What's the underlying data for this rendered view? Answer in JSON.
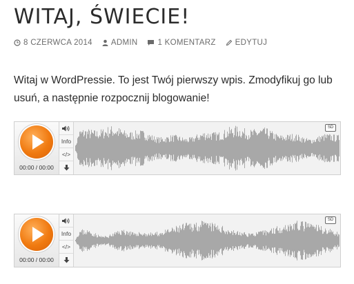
{
  "post": {
    "title": "WITAJ, ŚWIECIE!",
    "meta": {
      "date": "8 CZERWCA 2014",
      "author": "ADMIN",
      "comments": "1 KOMENTARZ",
      "edit": "EDYTUJ"
    },
    "content": "Witaj w WordPressie. To jest Twój pierwszy wpis. Zmodyfikuj go lub usuń, a następnie rozpocznij blogowanie!"
  },
  "players": [
    {
      "time": "00:00 / 00:00",
      "info_label": "Info",
      "embed_label": "</>",
      "quality_badge": "SD"
    },
    {
      "time": "00:00 / 00:00",
      "info_label": "Info",
      "embed_label": "</>",
      "quality_badge": "SD"
    }
  ],
  "colors": {
    "play_accent": "#f07a10",
    "waveform": "#a8a8a8"
  }
}
